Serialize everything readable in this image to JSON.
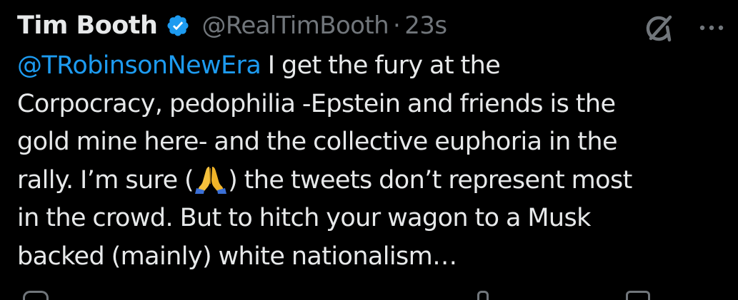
{
  "tweet": {
    "author": {
      "display_name": "Tim Booth",
      "handle": "@RealTimBooth",
      "separator": "·",
      "time": "23s",
      "verified": true
    },
    "text": {
      "mention": "@TRobinsonNewEra",
      "line1_rest": " I get the fury at the",
      "line2": "Corpocracy, pedophilia -Epstein and friends is the",
      "line3": "gold mine here- and the collective euphoria in the",
      "line4_pre": "rally. I’m sure (",
      "line4_emoji": "folded-hands-emoji",
      "line4_post": ") the tweets don’t represent most",
      "line5": "in the crowd. But to hitch your wagon to a Musk",
      "line6": "backed (mainly) white nationalism…"
    },
    "icons": {
      "verified": "verified-badge-icon",
      "grok": "grok-icon",
      "more": "more-icon"
    }
  },
  "colors": {
    "background": "#000000",
    "text": "#e7e9ea",
    "secondary": "#71767b",
    "accent": "#1d9bf0"
  }
}
